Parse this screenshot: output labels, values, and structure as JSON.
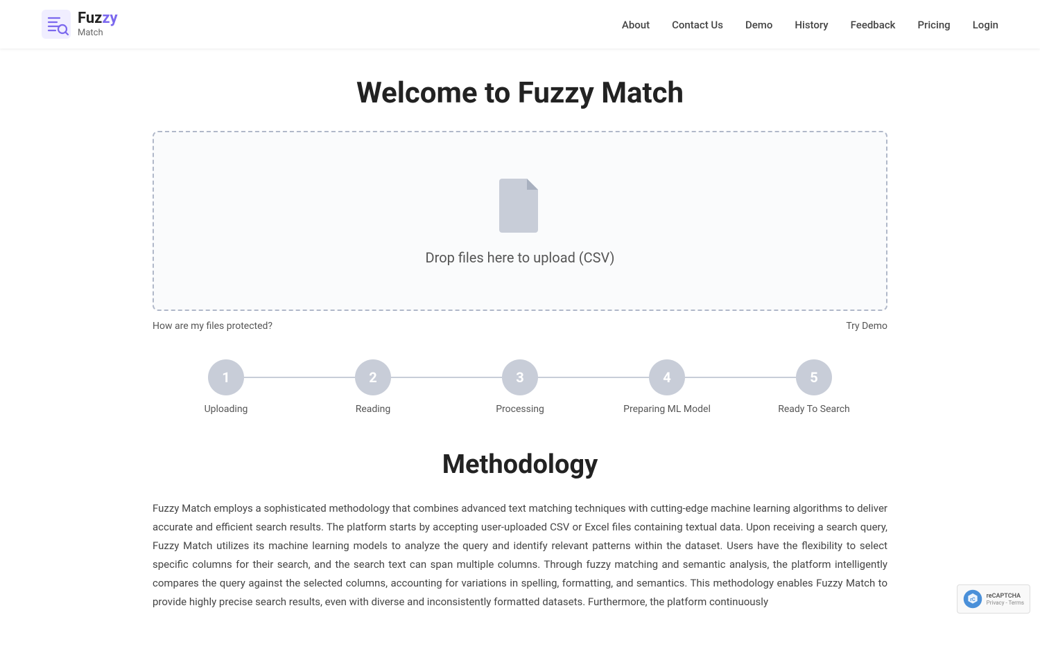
{
  "brand": {
    "name_part1": "Fuz",
    "name_part2": "zy",
    "name_part3": "Match",
    "tagline": "Match"
  },
  "navbar": {
    "about_label": "About",
    "contact_label": "Contact Us",
    "demo_label": "Demo",
    "history_label": "History",
    "feedback_label": "Feedback",
    "pricing_label": "Pricing",
    "login_label": "Login"
  },
  "hero": {
    "title": "Welcome to Fuzzy Match",
    "dropzone_text": "Drop files here to upload (CSV)"
  },
  "links": {
    "protection_label": "How are my files protected?",
    "try_demo_label": "Try Demo"
  },
  "steps": [
    {
      "number": "1",
      "label": "Uploading"
    },
    {
      "number": "2",
      "label": "Reading"
    },
    {
      "number": "3",
      "label": "Processing"
    },
    {
      "number": "4",
      "label": "Preparing ML Model"
    },
    {
      "number": "5",
      "label": "Ready To Search"
    }
  ],
  "methodology": {
    "title": "Methodology",
    "text": "Fuzzy Match employs a sophisticated methodology that combines advanced text matching techniques with cutting-edge machine learning algorithms to deliver accurate and efficient search results. The platform starts by accepting user-uploaded CSV or Excel files containing textual data. Upon receiving a search query, Fuzzy Match utilizes its machine learning models to analyze the query and identify relevant patterns within the dataset. Users have the flexibility to select specific columns for their search, and the search text can span multiple columns. Through fuzzy matching and semantic analysis, the platform intelligently compares the query against the selected columns, accounting for variations in spelling, formatting, and semantics. This methodology enables Fuzzy Match to provide highly precise search results, even with diverse and inconsistently formatted datasets. Furthermore, the platform continuously"
  }
}
